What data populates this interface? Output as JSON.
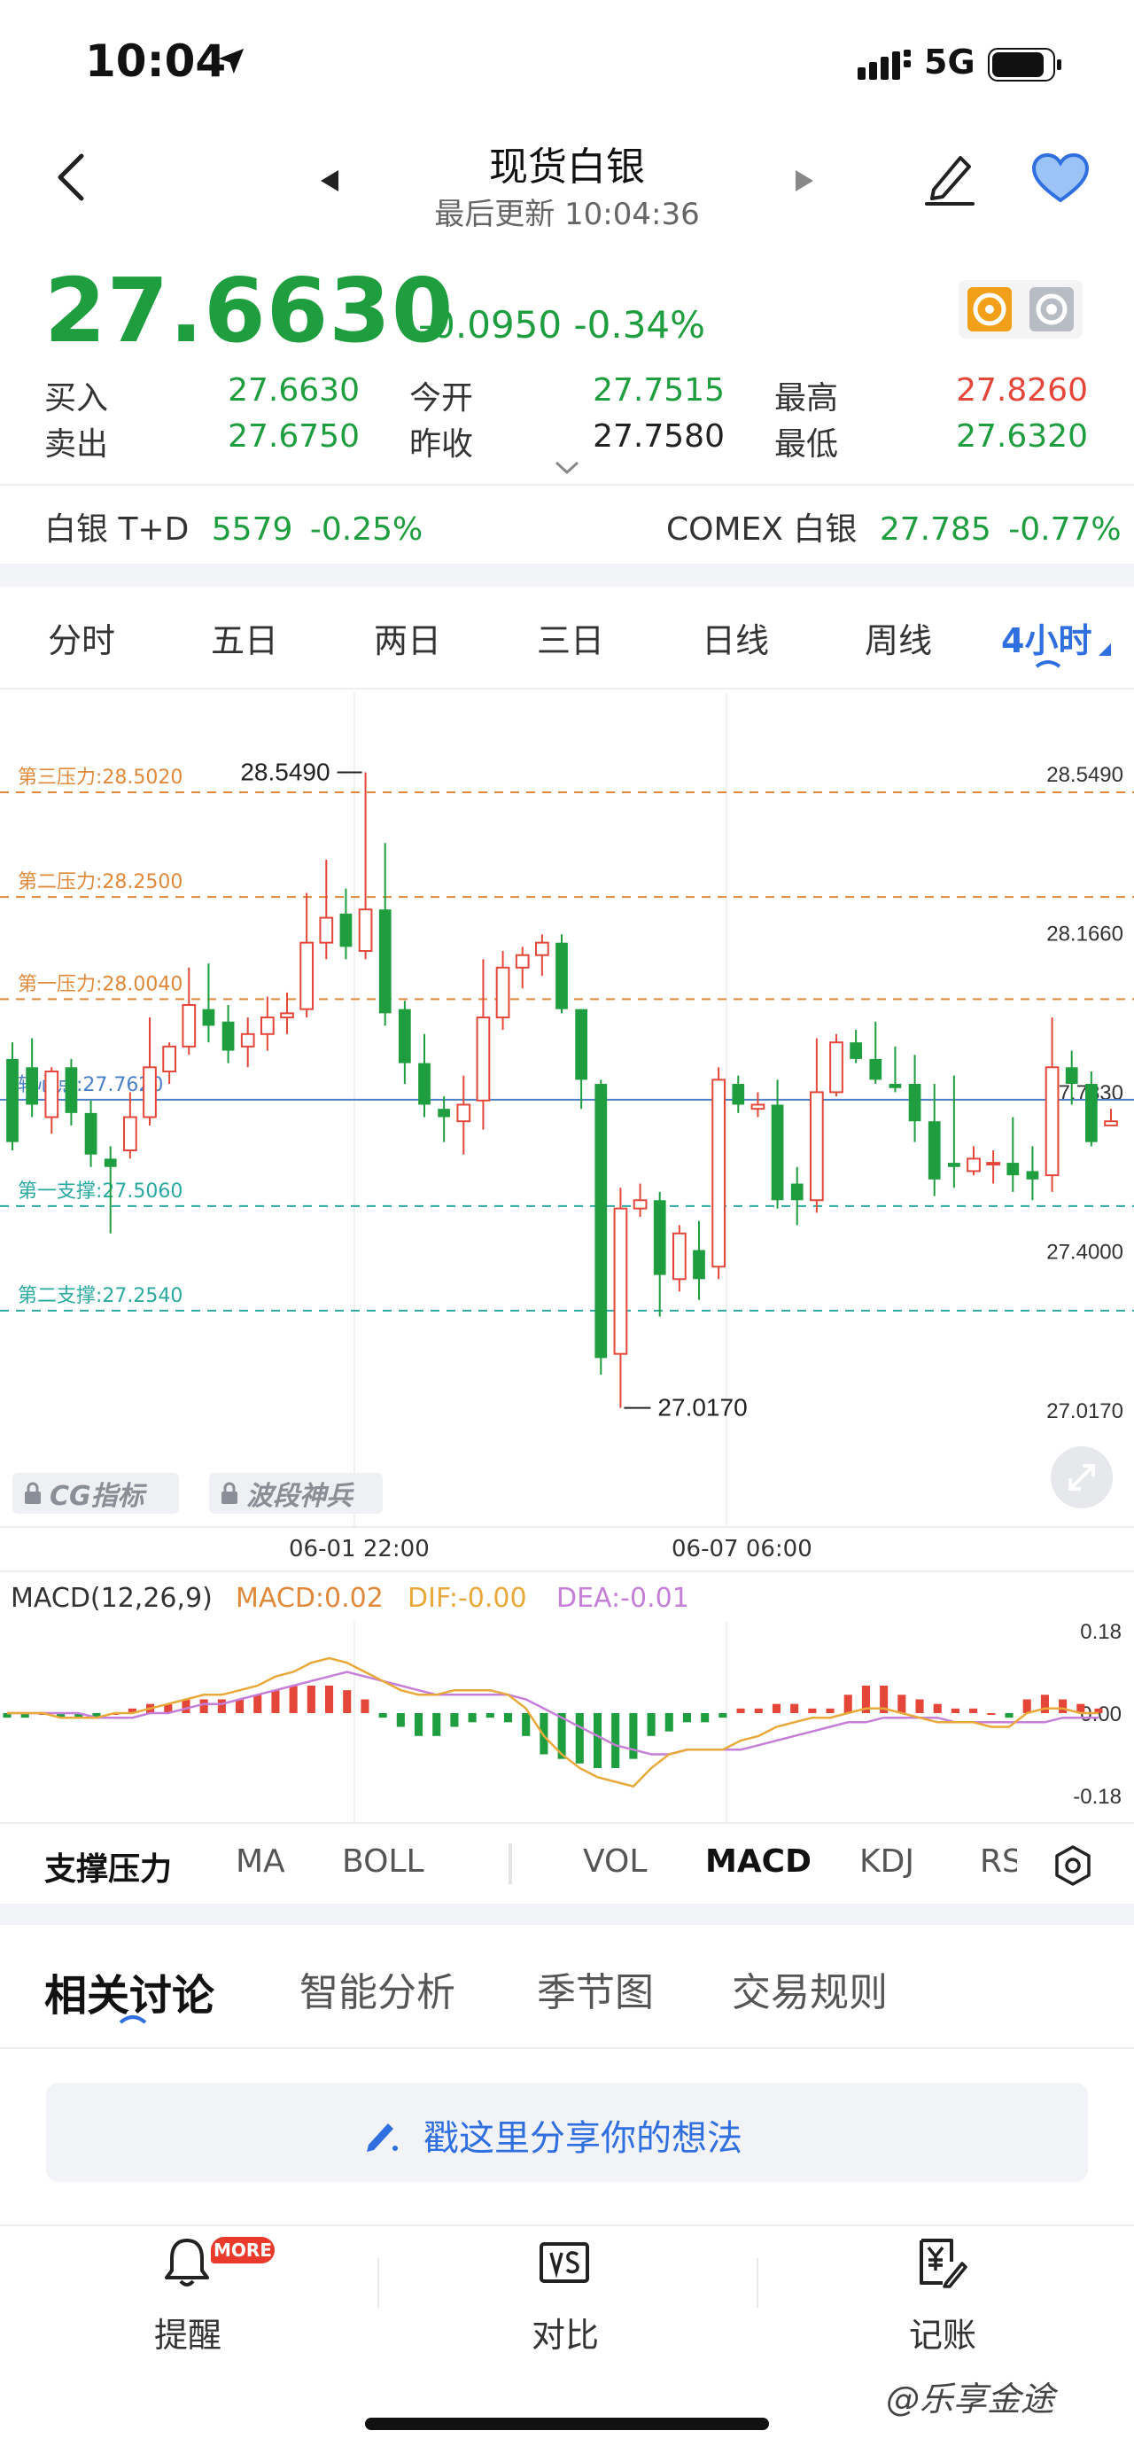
{
  "status": {
    "time": "10:04",
    "network": "5G"
  },
  "header": {
    "title": "现货白银",
    "subtitle": "最后更新 10:04:36"
  },
  "price": {
    "last": "27.6630",
    "change": "-0.0950",
    "change_pct": "-0.34%"
  },
  "quote": {
    "bid_label": "买入",
    "bid": "27.6630",
    "ask_label": "卖出",
    "ask": "27.6750",
    "open_label": "今开",
    "open": "27.7515",
    "prev_label": "昨收",
    "prev": "27.7580",
    "high_label": "最高",
    "high": "27.8260",
    "low_label": "最低",
    "low": "27.6320"
  },
  "related": [
    {
      "name": "白银 T+D",
      "value": "5579",
      "change": "-0.25%"
    },
    {
      "name": "COMEX 白银",
      "value": "27.785",
      "change": "-0.77%"
    }
  ],
  "timeframes": [
    "分时",
    "五日",
    "两日",
    "三日",
    "日线",
    "周线",
    "4小时"
  ],
  "active_timeframe": "4小时",
  "colors": {
    "up": "#e4473a",
    "down": "#1e9e3e",
    "accent": "#2f6fe0"
  },
  "chart_data": {
    "type": "candlestick",
    "ylim": [
      27.017,
      28.549
    ],
    "y_ticks": [
      "28.5490",
      "28.1660",
      "27.7830",
      "27.4000",
      "27.0170"
    ],
    "x_labels": [
      "06-01 22:00",
      "06-07 06:00"
    ],
    "high_marker": "28.5490",
    "low_marker": "27.0170",
    "levels": [
      {
        "label": "第三压力:28.5020",
        "value": 28.502,
        "color": "#e0893a"
      },
      {
        "label": "第二压力:28.2500",
        "value": 28.25,
        "color": "#e0893a"
      },
      {
        "label": "第一压力:28.0040",
        "value": 28.004,
        "color": "#e0893a"
      },
      {
        "label": "轴心点:27.7620",
        "value": 27.762,
        "color": "#4a7fc9"
      },
      {
        "label": "第一支撑:27.5060",
        "value": 27.506,
        "color": "#2aa9a0"
      },
      {
        "label": "第二支撑:27.2540",
        "value": 27.254,
        "color": "#2aa9a0"
      }
    ],
    "candles": [
      [
        27.86,
        27.66,
        27.9,
        27.64
      ],
      [
        27.84,
        27.75,
        27.91,
        27.72
      ],
      [
        27.72,
        27.83,
        27.84,
        27.68
      ],
      [
        27.84,
        27.73,
        27.86,
        27.7
      ],
      [
        27.73,
        27.63,
        27.76,
        27.6
      ],
      [
        27.62,
        27.6,
        27.65,
        27.44
      ],
      [
        27.64,
        27.72,
        27.78,
        27.62
      ],
      [
        27.72,
        27.84,
        27.96,
        27.7
      ],
      [
        27.83,
        27.89,
        27.9,
        27.8
      ],
      [
        27.89,
        27.99,
        28.08,
        27.87
      ],
      [
        27.98,
        27.94,
        28.09,
        27.9
      ],
      [
        27.95,
        27.88,
        27.99,
        27.85
      ],
      [
        27.89,
        27.92,
        27.96,
        27.84
      ],
      [
        27.92,
        27.96,
        28.01,
        27.88
      ],
      [
        27.96,
        27.97,
        28.02,
        27.92
      ],
      [
        27.98,
        28.14,
        28.26,
        27.96
      ],
      [
        28.14,
        28.2,
        28.34,
        28.1
      ],
      [
        28.21,
        28.13,
        28.27,
        28.1
      ],
      [
        28.12,
        28.22,
        28.55,
        28.1
      ],
      [
        28.22,
        27.97,
        28.38,
        27.94
      ],
      [
        27.98,
        27.85,
        28.0,
        27.8
      ],
      [
        27.85,
        27.75,
        27.92,
        27.72
      ],
      [
        27.74,
        27.72,
        27.77,
        27.66
      ],
      [
        27.71,
        27.75,
        27.82,
        27.63
      ],
      [
        27.76,
        27.96,
        28.1,
        27.69
      ],
      [
        27.96,
        28.08,
        28.12,
        27.93
      ],
      [
        28.08,
        28.11,
        28.13,
        28.03
      ],
      [
        28.11,
        28.14,
        28.16,
        28.06
      ],
      [
        28.14,
        27.98,
        28.16,
        27.97
      ],
      [
        27.98,
        27.81,
        27.93,
        27.74
      ],
      [
        27.8,
        27.14,
        27.81,
        27.1
      ],
      [
        27.15,
        27.5,
        27.55,
        27.02
      ],
      [
        27.5,
        27.52,
        27.56,
        27.48
      ],
      [
        27.52,
        27.34,
        27.54,
        27.24
      ],
      [
        27.33,
        27.44,
        27.46,
        27.3
      ],
      [
        27.4,
        27.33,
        27.47,
        27.28
      ],
      [
        27.36,
        27.81,
        27.84,
        27.33
      ],
      [
        27.8,
        27.75,
        27.82,
        27.73
      ],
      [
        27.74,
        27.75,
        27.78,
        27.72
      ],
      [
        27.75,
        27.52,
        27.81,
        27.5
      ],
      [
        27.56,
        27.52,
        27.6,
        27.46
      ],
      [
        27.52,
        27.78,
        27.91,
        27.49
      ],
      [
        27.78,
        27.9,
        27.92,
        27.77
      ],
      [
        27.9,
        27.86,
        27.93,
        27.85
      ],
      [
        27.86,
        27.81,
        27.95,
        27.8
      ],
      [
        27.8,
        27.79,
        27.89,
        27.78
      ],
      [
        27.8,
        27.71,
        27.87,
        27.66
      ],
      [
        27.71,
        27.57,
        27.8,
        27.53
      ],
      [
        27.61,
        27.6,
        27.82,
        27.55
      ],
      [
        27.59,
        27.62,
        27.65,
        27.58
      ],
      [
        27.61,
        27.61,
        27.64,
        27.56
      ],
      [
        27.61,
        27.58,
        27.72,
        27.54
      ],
      [
        27.59,
        27.57,
        27.65,
        27.52
      ],
      [
        27.58,
        27.84,
        27.96,
        27.54
      ],
      [
        27.84,
        27.8,
        27.88,
        27.75
      ],
      [
        27.8,
        27.66,
        27.83,
        27.65
      ],
      [
        27.7,
        27.71,
        27.74,
        27.7
      ]
    ]
  },
  "lock_buttons": [
    "CG指标",
    "波段神兵"
  ],
  "macd": {
    "title": "MACD(12,26,9)",
    "macd_label": "MACD:0.02",
    "dif_label": "DIF:-0.00",
    "dea_label": "DEA:-0.01",
    "y_ticks": [
      "0.18",
      "0.00",
      "-0.18"
    ],
    "ylim": [
      -0.18,
      0.18
    ],
    "colors": {
      "macd": "#e0893a",
      "dif": "#e8a93a",
      "dea": "#c57fd8"
    },
    "hist": [
      -0.01,
      -0.01,
      0.0,
      -0.01,
      -0.01,
      -0.01,
      0.0,
      0.01,
      0.02,
      0.02,
      0.03,
      0.03,
      0.03,
      0.03,
      0.04,
      0.05,
      0.06,
      0.06,
      0.06,
      0.05,
      0.03,
      -0.01,
      -0.03,
      -0.05,
      -0.05,
      -0.03,
      -0.02,
      -0.01,
      -0.02,
      -0.05,
      -0.09,
      -0.1,
      -0.11,
      -0.12,
      -0.12,
      -0.1,
      -0.05,
      -0.04,
      -0.02,
      -0.02,
      -0.01,
      0.01,
      0.01,
      0.02,
      0.02,
      0.01,
      0.01,
      0.04,
      0.06,
      0.06,
      0.04,
      0.03,
      0.02,
      0.01,
      0.01,
      0.0,
      -0.01,
      0.03,
      0.04,
      0.03,
      0.02,
      0.01
    ],
    "dif": [
      0.0,
      0.0,
      0.0,
      -0.01,
      -0.01,
      -0.01,
      0.0,
      0.0,
      0.01,
      0.02,
      0.03,
      0.04,
      0.04,
      0.05,
      0.06,
      0.08,
      0.09,
      0.11,
      0.12,
      0.11,
      0.09,
      0.07,
      0.05,
      0.04,
      0.04,
      0.05,
      0.05,
      0.05,
      0.04,
      0.01,
      -0.05,
      -0.09,
      -0.12,
      -0.14,
      -0.15,
      -0.16,
      -0.12,
      -0.09,
      -0.08,
      -0.08,
      -0.08,
      -0.06,
      -0.05,
      -0.03,
      -0.02,
      -0.01,
      -0.01,
      0.0,
      0.01,
      0.01,
      0.0,
      -0.01,
      -0.02,
      -0.02,
      -0.02,
      -0.03,
      -0.03,
      0.0,
      0.01,
      0.01,
      0.0,
      -0.0
    ],
    "dea": [
      0.0,
      0.0,
      0.0,
      0.0,
      0.0,
      -0.01,
      -0.01,
      -0.01,
      0.0,
      0.0,
      0.01,
      0.02,
      0.02,
      0.03,
      0.04,
      0.05,
      0.06,
      0.07,
      0.08,
      0.09,
      0.08,
      0.07,
      0.06,
      0.05,
      0.04,
      0.04,
      0.04,
      0.04,
      0.04,
      0.03,
      0.01,
      -0.01,
      -0.03,
      -0.05,
      -0.07,
      -0.08,
      -0.09,
      -0.09,
      -0.08,
      -0.08,
      -0.08,
      -0.08,
      -0.07,
      -0.06,
      -0.05,
      -0.04,
      -0.03,
      -0.02,
      -0.02,
      -0.01,
      -0.01,
      -0.01,
      -0.01,
      -0.02,
      -0.02,
      -0.02,
      -0.02,
      -0.02,
      -0.02,
      -0.01,
      -0.01,
      -0.01
    ]
  },
  "indicator_tabs": [
    "支撑压力",
    "MA",
    "BOLL",
    "VOL",
    "MACD",
    "KDJ",
    "RS"
  ],
  "active_indicators": [
    "支撑压力",
    "MACD"
  ],
  "discussion_tabs": [
    "相关讨论",
    "智能分析",
    "季节图",
    "交易规则"
  ],
  "share_placeholder": "戳这里分享你的想法",
  "bottom_bar": [
    {
      "label": "提醒",
      "badge": "MORE"
    },
    {
      "label": "对比"
    },
    {
      "label": "记账"
    }
  ],
  "watermark": "@乐享金途"
}
